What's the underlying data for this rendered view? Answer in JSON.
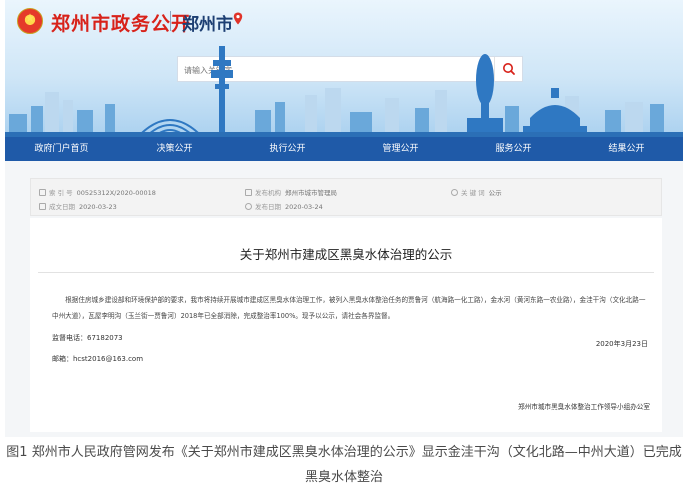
{
  "header": {
    "site_title": "郑州市政务公开",
    "city_name": "郑州市",
    "search_placeholder": "请输入关键字"
  },
  "nav": {
    "items": [
      {
        "label": "政府门户首页"
      },
      {
        "label": "决策公开"
      },
      {
        "label": "执行公开"
      },
      {
        "label": "管理公开"
      },
      {
        "label": "服务公开"
      },
      {
        "label": "结果公开"
      }
    ]
  },
  "meta": {
    "index_label": "索 引 号",
    "index_value": "00525312X/2020-00018",
    "publisher_label": "发布机构",
    "publisher_value": "郑州市城市管理局",
    "keyword_label": "关 键 词",
    "keyword_value": "公示",
    "created_label": "成文日期",
    "created_value": "2020-03-23",
    "published_label": "发布日期",
    "published_value": "2020-03-24"
  },
  "document": {
    "title": "关于郑州市建成区黑臭水体治理的公示",
    "body": "根据住房城乡建设部和环境保护部的要求，我市将持续开展城市建成区黑臭水体治理工作，被列入黑臭水体整治任务的贾鲁河（航海路一化工路），金水河（黄河东路一农业路），金洼干沟（文化北路一中州大道），瓦屋李明沟（玉兰街一贾鲁河）2018年已全部消除，完成整治率100%。现予以公示，请社会各界监督。",
    "phone": "监督电话：67182073",
    "email": "邮箱：hcst2016@163.com",
    "date": "2020年3月23日",
    "signature": "郑州市城市黑臭水体整治工作领导小组办公室"
  },
  "caption": "图1 郑州市人民政府管网发布《关于郑州市建成区黑臭水体治理的公示》显示金洼干沟（文化北路—中州大道）已完成黑臭水体整治",
  "colors": {
    "brand_red": "#d8221a",
    "nav_blue": "#1f5aa8"
  },
  "icons": [
    "emblem-icon",
    "location-pin-icon",
    "search-icon"
  ]
}
